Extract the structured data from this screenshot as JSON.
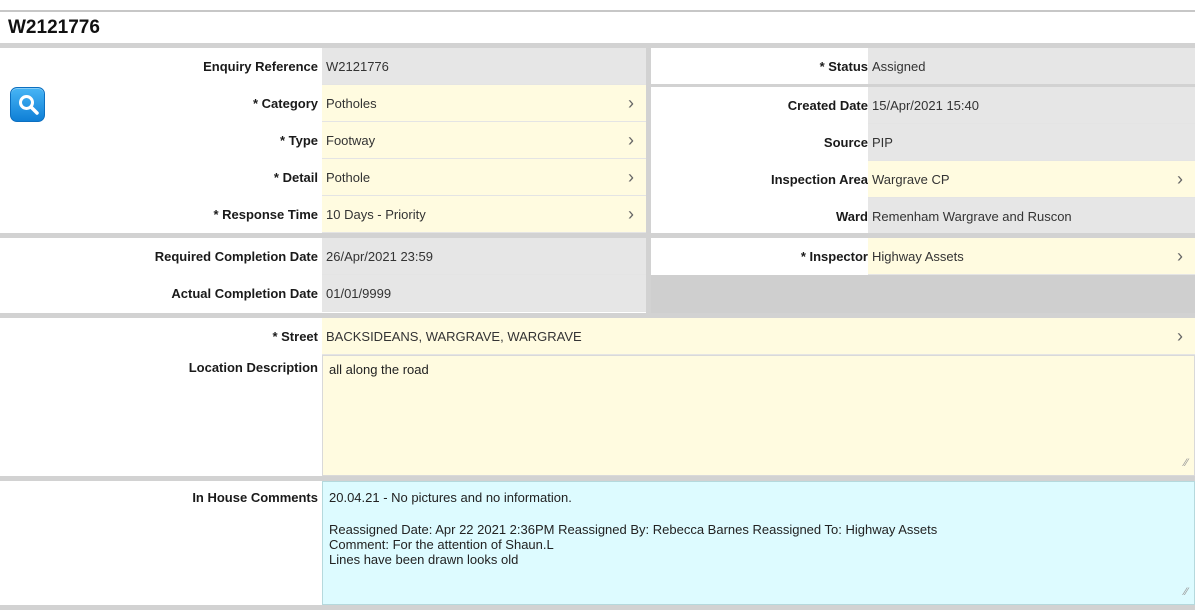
{
  "title": "W2121776",
  "icons": {
    "search": "search-icon",
    "chevron": "chevron-right-icon",
    "resize": "resize-handle-icon"
  },
  "left": {
    "enquiry_reference": {
      "label": "Enquiry Reference",
      "value": "W2121776"
    },
    "category": {
      "label": "* Category",
      "value": "Potholes"
    },
    "type": {
      "label": "* Type",
      "value": "Footway"
    },
    "detail": {
      "label": "* Detail",
      "value": "Pothole"
    },
    "response_time": {
      "label": "* Response Time",
      "value": "10 Days - Priority"
    },
    "required_completion": {
      "label": "Required Completion Date",
      "value": "26/Apr/2021 23:59"
    },
    "actual_completion": {
      "label": "Actual Completion Date",
      "value": "01/01/9999"
    }
  },
  "right": {
    "status": {
      "label": "* Status",
      "value": "Assigned"
    },
    "created_date": {
      "label": "Created Date",
      "value": "15/Apr/2021 15:40"
    },
    "source": {
      "label": "Source",
      "value": "PIP"
    },
    "inspection_area": {
      "label": "Inspection Area",
      "value": "Wargrave CP"
    },
    "ward": {
      "label": "Ward",
      "value": "Remenham Wargrave and Ruscon"
    },
    "inspector": {
      "label": "* Inspector",
      "value": "Highway Assets"
    }
  },
  "street": {
    "label": "* Street",
    "value": "BACKSIDEANS, WARGRAVE, WARGRAVE"
  },
  "location": {
    "label": "Location Description",
    "value": "all along the road"
  },
  "comments": {
    "label": "In House Comments",
    "line1": "20.04.21 - No pictures and no information.",
    "line2": "Reassigned Date:  Apr 22 2021  2:36PM Reassigned By:  Rebecca Barnes Reassigned To:  Highway Assets",
    "line3": "Comment:  For the attention of Shaun.L",
    "line4": "Lines have been drawn looks old"
  },
  "colors": {
    "editable": "#fffbe0",
    "readonly": "#e6e6e6",
    "comments": "#ddfbff",
    "accent": "#1a8ae0"
  }
}
